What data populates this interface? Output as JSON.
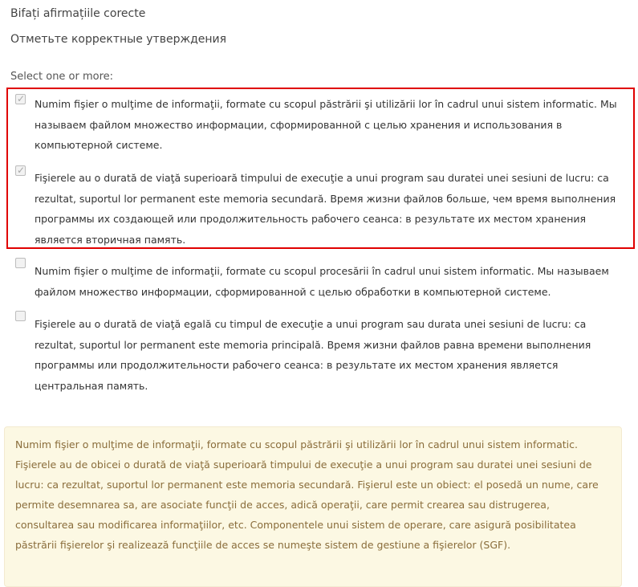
{
  "question": {
    "text_ro": "Bifați afirmațiile corecte",
    "text_ru": "Отметьте корректные утверждения",
    "prompt": "Select one or more:"
  },
  "options": [
    {
      "checked": true,
      "text": "Numim fişier o mulţime de informaţii, formate cu scopul păstrării şi utilizării lor în cadrul unui sistem informatic.   Мы называем файлом множество информации, сформированной с целью хранения и использования в компьютерной системе."
    },
    {
      "checked": true,
      "text": "Fişierele au o durată de viaţă superioară timpului de execuţie a unui program sau duratei unei sesiuni de lucru: ca rezultat, suportul lor permanent este memoria secundară.  Время жизни файлов больше, чем время выполнения программы их создающей  или продолжительность рабочего сеанса: в результате их местом хранения является вторичная память."
    },
    {
      "checked": false,
      "text": "Numim fişier o mulţime de informaţii, formate cu scopul procesării în cadrul unui sistem informatic.   Мы называем файлом множество информации, сформированной с целью обработки в компьютерной системе."
    },
    {
      "checked": false,
      "text": "Fişierele au o durată de viaţă egală cu timpul de execuţie a unui program sau durata unei sesiuni de lucru: ca rezultat, suportul lor permanent este memoria principală.  Время жизни файлов равна времени выполнения программы  или продолжительности рабочего сеанса: в результате их местом хранения является центральная память."
    }
  ],
  "feedback": {
    "text": "Numim fişier o mulţime de informaţii, formate cu scopul păstrării şi utilizării lor în cadrul unui sistem informatic. Fişierele au de obicei o durată de viaţă superioară timpului de execuţie a unui program sau duratei unei sesiuni de lucru: ca rezultat, suportul lor permanent este memoria secundară. Fişierul este un obiect: el posedă un nume, care permite desemnarea sa, are asociate funcţii de acces, adică operaţii, care permit crearea sau distrugerea, consultarea sau modificarea informaţiilor, etc. Componentele unui sistem de operare, care asigură posibilitatea păstrării fişierelor şi realizează funcţiile de acces se numeşte sistem de gestiune a fişierelor (SGF)."
  },
  "icons": {
    "checkbox_checked": "checkmark-icon"
  },
  "colors": {
    "highlight_border": "#e00000",
    "feedback_bg": "#fcf8e3",
    "feedback_text": "#8a6d3b"
  }
}
